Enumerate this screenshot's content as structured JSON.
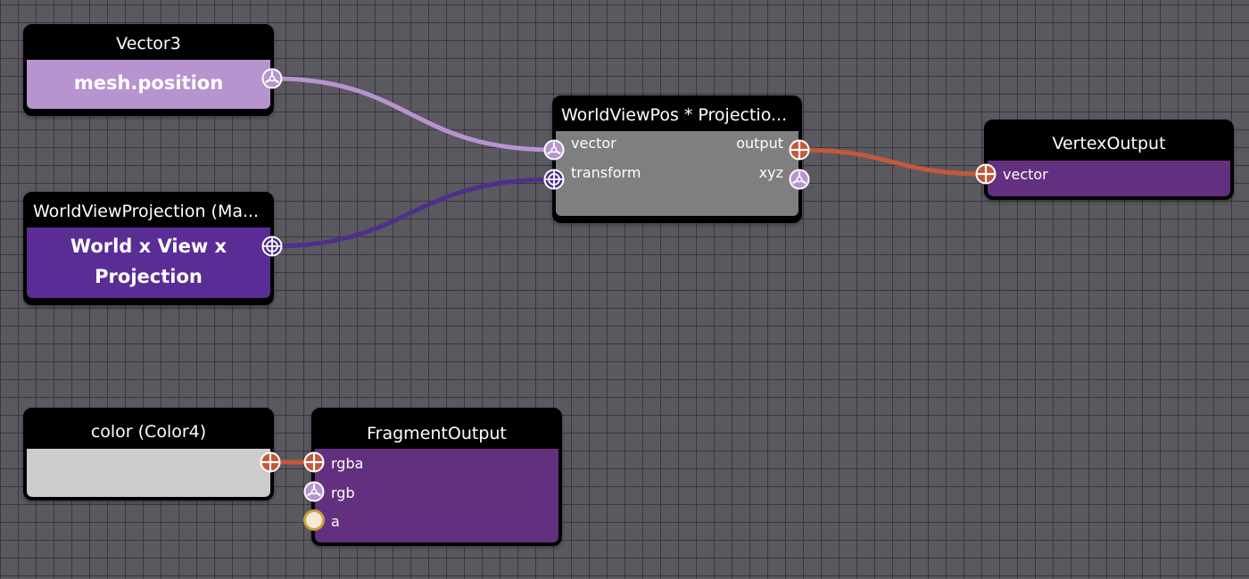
{
  "colors": {
    "vector3": "#b794cf",
    "matrix": "#4f2f8a",
    "color4": "#c2593a",
    "float": "#f3ead6",
    "float_ring": "#c9a23c",
    "gray_body": "#7f7f7f",
    "output_body": "#63307f",
    "color_swatch": "#cccccc"
  },
  "nodes": {
    "vector3": {
      "title": "Vector3",
      "value": "mesh.position"
    },
    "wvp": {
      "title": "WorldViewProjection (Ma...",
      "value_line1": "World x View x",
      "value_line2": "Projection"
    },
    "transform": {
      "title": "WorldViewPos * Projectio...",
      "in_vector": "vector",
      "in_transform": "transform",
      "out_output": "output",
      "out_xyz": "xyz"
    },
    "vertex_output": {
      "title": "VertexOutput",
      "in_vector": "vector"
    },
    "color": {
      "title": "color (Color4)"
    },
    "fragment_output": {
      "title": "FragmentOutput",
      "in_rgba": "rgba",
      "in_rgb": "rgb",
      "in_a": "a"
    }
  },
  "links": [
    {
      "from": "vector3.out",
      "to": "transform.vector",
      "type": "vector3"
    },
    {
      "from": "wvp.out",
      "to": "transform.transform",
      "type": "matrix"
    },
    {
      "from": "transform.output",
      "to": "vertex_output.vector",
      "type": "color4"
    },
    {
      "from": "color.out",
      "to": "fragment_output.rgba",
      "type": "color4"
    }
  ]
}
